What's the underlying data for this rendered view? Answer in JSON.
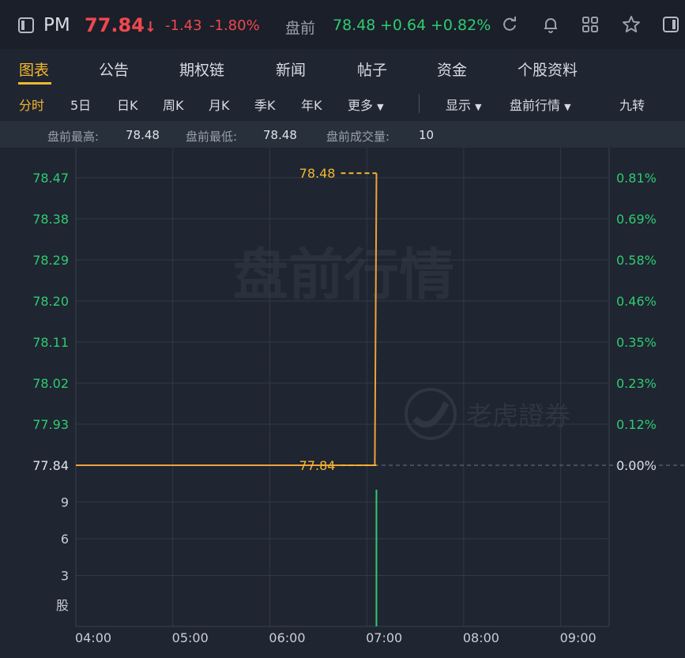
{
  "header": {
    "symbol": "PM",
    "price": "77.84",
    "price_arrow": "↓",
    "change": "-1.43",
    "change_pct": "-1.80%",
    "premarket_label": "盘前",
    "premarket_price": "78.48",
    "premarket_change": "+0.64",
    "premarket_change_pct": "+0.82%",
    "icons": [
      "sidebar-toggle-icon",
      "refresh-icon",
      "bell-icon",
      "grid-icon",
      "star-icon",
      "panel-icon"
    ]
  },
  "tabs": [
    {
      "label": "图表",
      "active": true
    },
    {
      "label": "公告"
    },
    {
      "label": "期权链"
    },
    {
      "label": "新闻"
    },
    {
      "label": "帖子"
    },
    {
      "label": "资金"
    },
    {
      "label": "个股资料"
    }
  ],
  "periods": {
    "items": [
      "分时",
      "5日",
      "日K",
      "周K",
      "月K",
      "季K",
      "年K",
      "更多"
    ],
    "active": "分时",
    "display_label": "显示",
    "premarket_quote_label": "盘前行情",
    "nine_turn_label": "九转"
  },
  "stats": {
    "high_label": "盘前最高:",
    "high": "78.48",
    "low_label": "盘前最低:",
    "low": "78.48",
    "volume_label": "盘前成交量:",
    "volume": "10"
  },
  "watermark": {
    "title": "盘前行情",
    "brand": "老虎證券"
  },
  "colors": {
    "background": "#1f2531",
    "up": "#2ecc71",
    "down": "#f0474f",
    "accent": "#f5b82e",
    "price_line": "#f0a23a"
  },
  "chart_data": {
    "type": "line",
    "title": "",
    "x_ticks": [
      "04:00",
      "05:00",
      "06:00",
      "07:00",
      "08:00",
      "09:00"
    ],
    "x_range": [
      "04:00",
      "09:30"
    ],
    "y_ticks_left": [
      "78.47",
      "78.38",
      "78.29",
      "78.20",
      "78.11",
      "78.02",
      "77.93",
      "77.84"
    ],
    "y_ticks_right": [
      "0.81%",
      "0.69%",
      "0.58%",
      "0.46%",
      "0.35%",
      "0.23%",
      "0.12%",
      "0.00%"
    ],
    "y_range": [
      77.84,
      78.48
    ],
    "prev_close": 77.84,
    "series": [
      {
        "x": [
          "04:00",
          "07:05",
          "07:06"
        ],
        "y": [
          77.84,
          77.84,
          78.48
        ]
      }
    ],
    "price_annotations": [
      {
        "label": "78.48",
        "value": 78.48
      },
      {
        "label": "77.84",
        "value": 77.84
      }
    ],
    "volume": {
      "y_ticks": [
        "9",
        "6",
        "3"
      ],
      "unit_label": "股",
      "max": 10,
      "bars": [
        {
          "x": "07:06",
          "value": 10
        }
      ]
    },
    "grid": true
  }
}
